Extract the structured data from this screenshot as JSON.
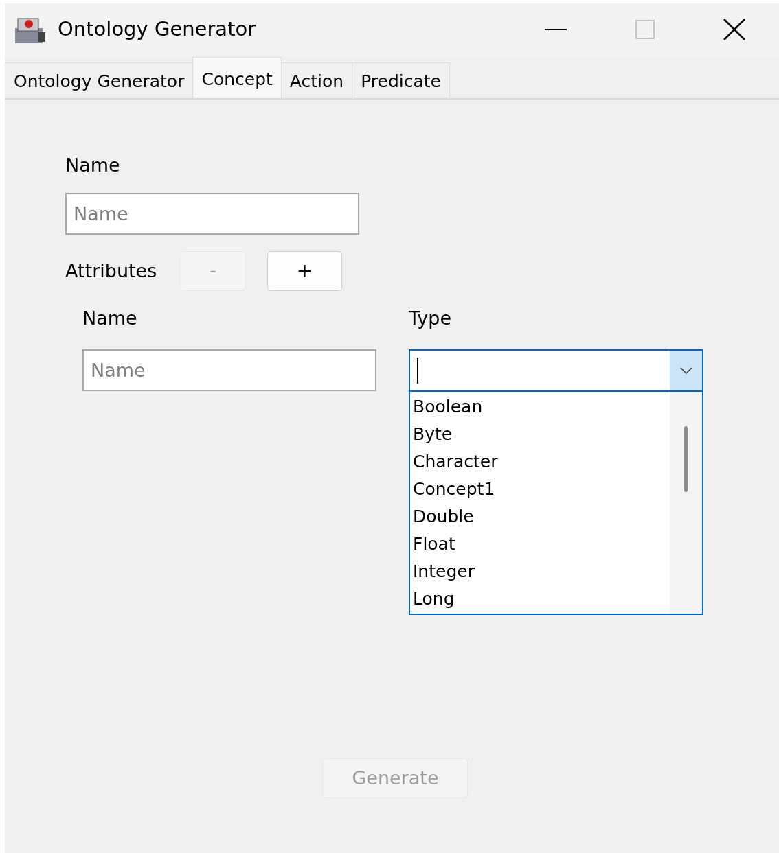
{
  "window": {
    "title": "Ontology Generator",
    "maximize_disabled": true
  },
  "tabs": [
    {
      "label": "Ontology Generator",
      "selected": false
    },
    {
      "label": "Concept",
      "selected": true
    },
    {
      "label": "Action",
      "selected": false
    },
    {
      "label": "Predicate",
      "selected": false
    }
  ],
  "concept": {
    "name_label": "Name",
    "name_field": {
      "placeholder": "Name"
    },
    "attributes_label": "Attributes",
    "buttons": [
      {
        "label": "-",
        "disabled": true
      },
      {
        "label": "+",
        "disabled": false
      }
    ],
    "columns": [
      "Name",
      "Type"
    ],
    "attribute_name": {
      "placeholder": "Name"
    },
    "type_combo": {
      "expanded": true,
      "options": [
        "Boolean",
        "Byte",
        "Character",
        "Concept1",
        "Double",
        "Float",
        "Integer",
        "Long"
      ]
    }
  },
  "generate": {
    "label": "Generate",
    "disabled": true
  }
}
